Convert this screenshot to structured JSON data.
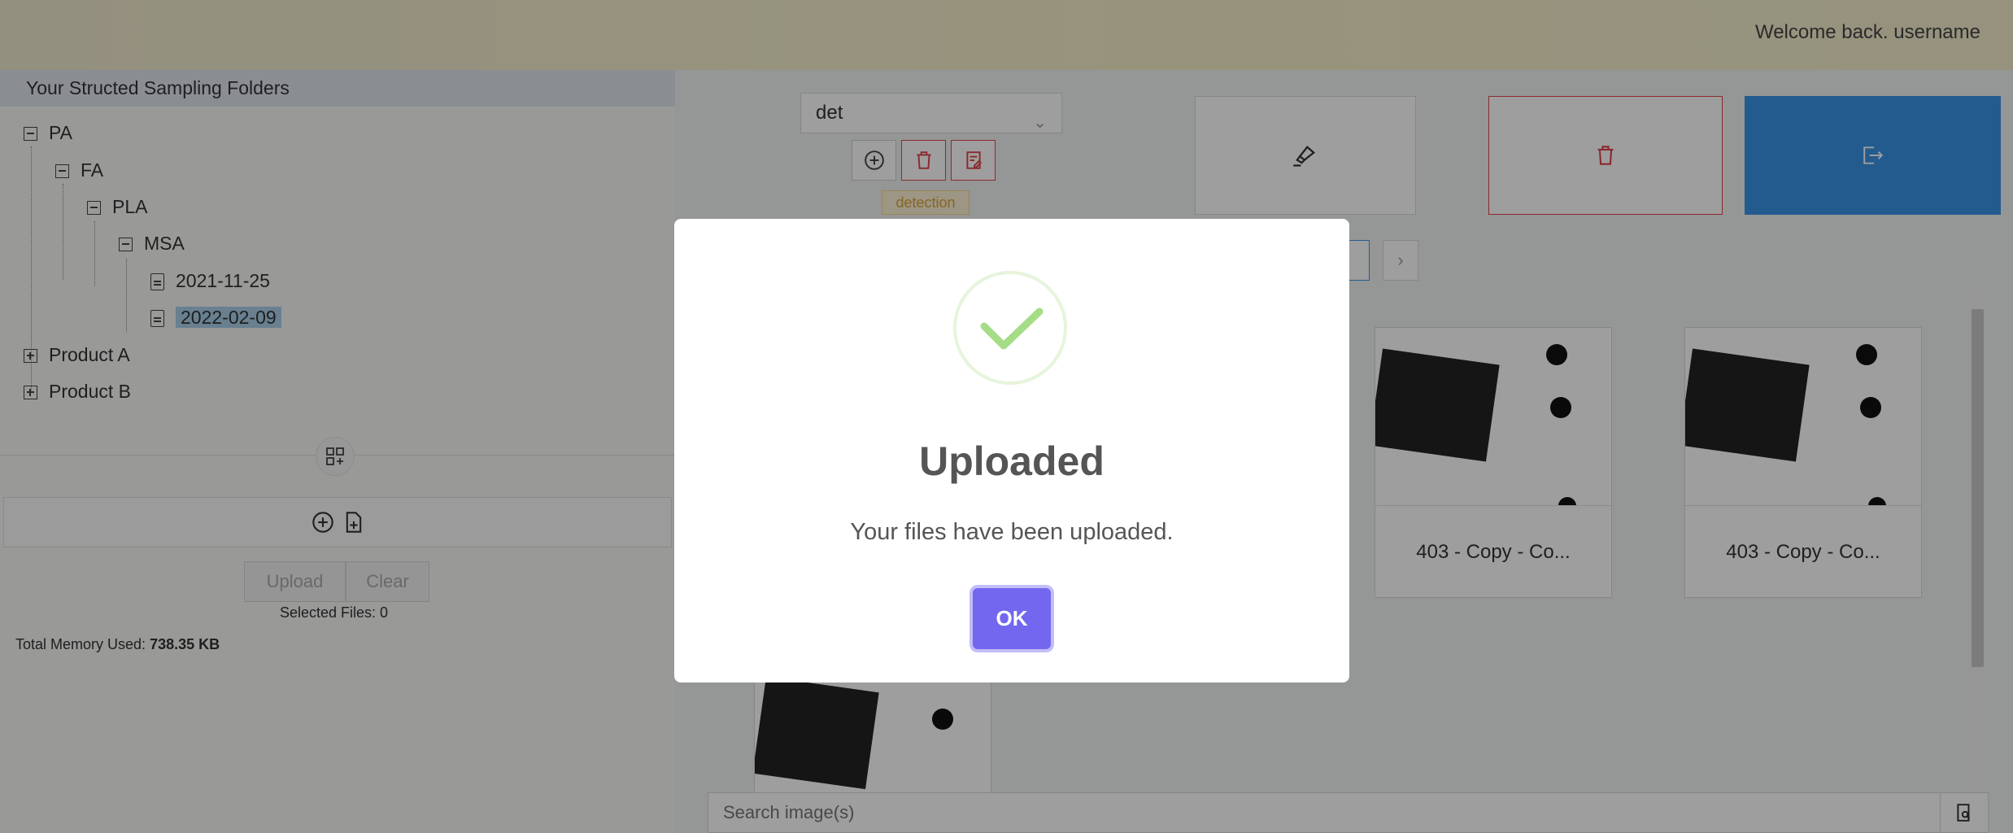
{
  "header": {
    "welcome": "Welcome back. username"
  },
  "left_panel": {
    "title": "Your Structed Sampling Folders",
    "tree": [
      {
        "label": "PA",
        "level": 0,
        "state": "expanded"
      },
      {
        "label": "FA",
        "level": 1,
        "state": "expanded"
      },
      {
        "label": "PLA",
        "level": 2,
        "state": "expanded"
      },
      {
        "label": "MSA",
        "level": 3,
        "state": "expanded"
      },
      {
        "label": "2021-11-25",
        "level": 4,
        "state": "file"
      },
      {
        "label": "2022-02-09",
        "level": 4,
        "state": "file-selected"
      },
      {
        "label": "Product A",
        "level": 0,
        "state": "collapsed"
      },
      {
        "label": "Product B",
        "level": 0,
        "state": "collapsed"
      }
    ],
    "upload_label": "Upload",
    "clear_label": "Clear",
    "selected_files": "Selected Files: 0",
    "memory_label": "Total Memory Used:",
    "memory_value": "738.35 KB"
  },
  "toolbar": {
    "select_value": "det",
    "tag_label": "detection"
  },
  "cards": [
    {
      "caption": "403 - Copy - Co..."
    },
    {
      "caption": "403 - Copy - Co..."
    }
  ],
  "search": {
    "placeholder": "Search image(s)"
  },
  "dialog": {
    "title": "Uploaded",
    "message": "Your files have been uploaded.",
    "ok_label": "OK"
  },
  "colors": {
    "accent_blue": "#3a93e6",
    "danger_red": "#e0454b",
    "ok_purple": "#7367f0",
    "success_green": "#a5dc86"
  }
}
